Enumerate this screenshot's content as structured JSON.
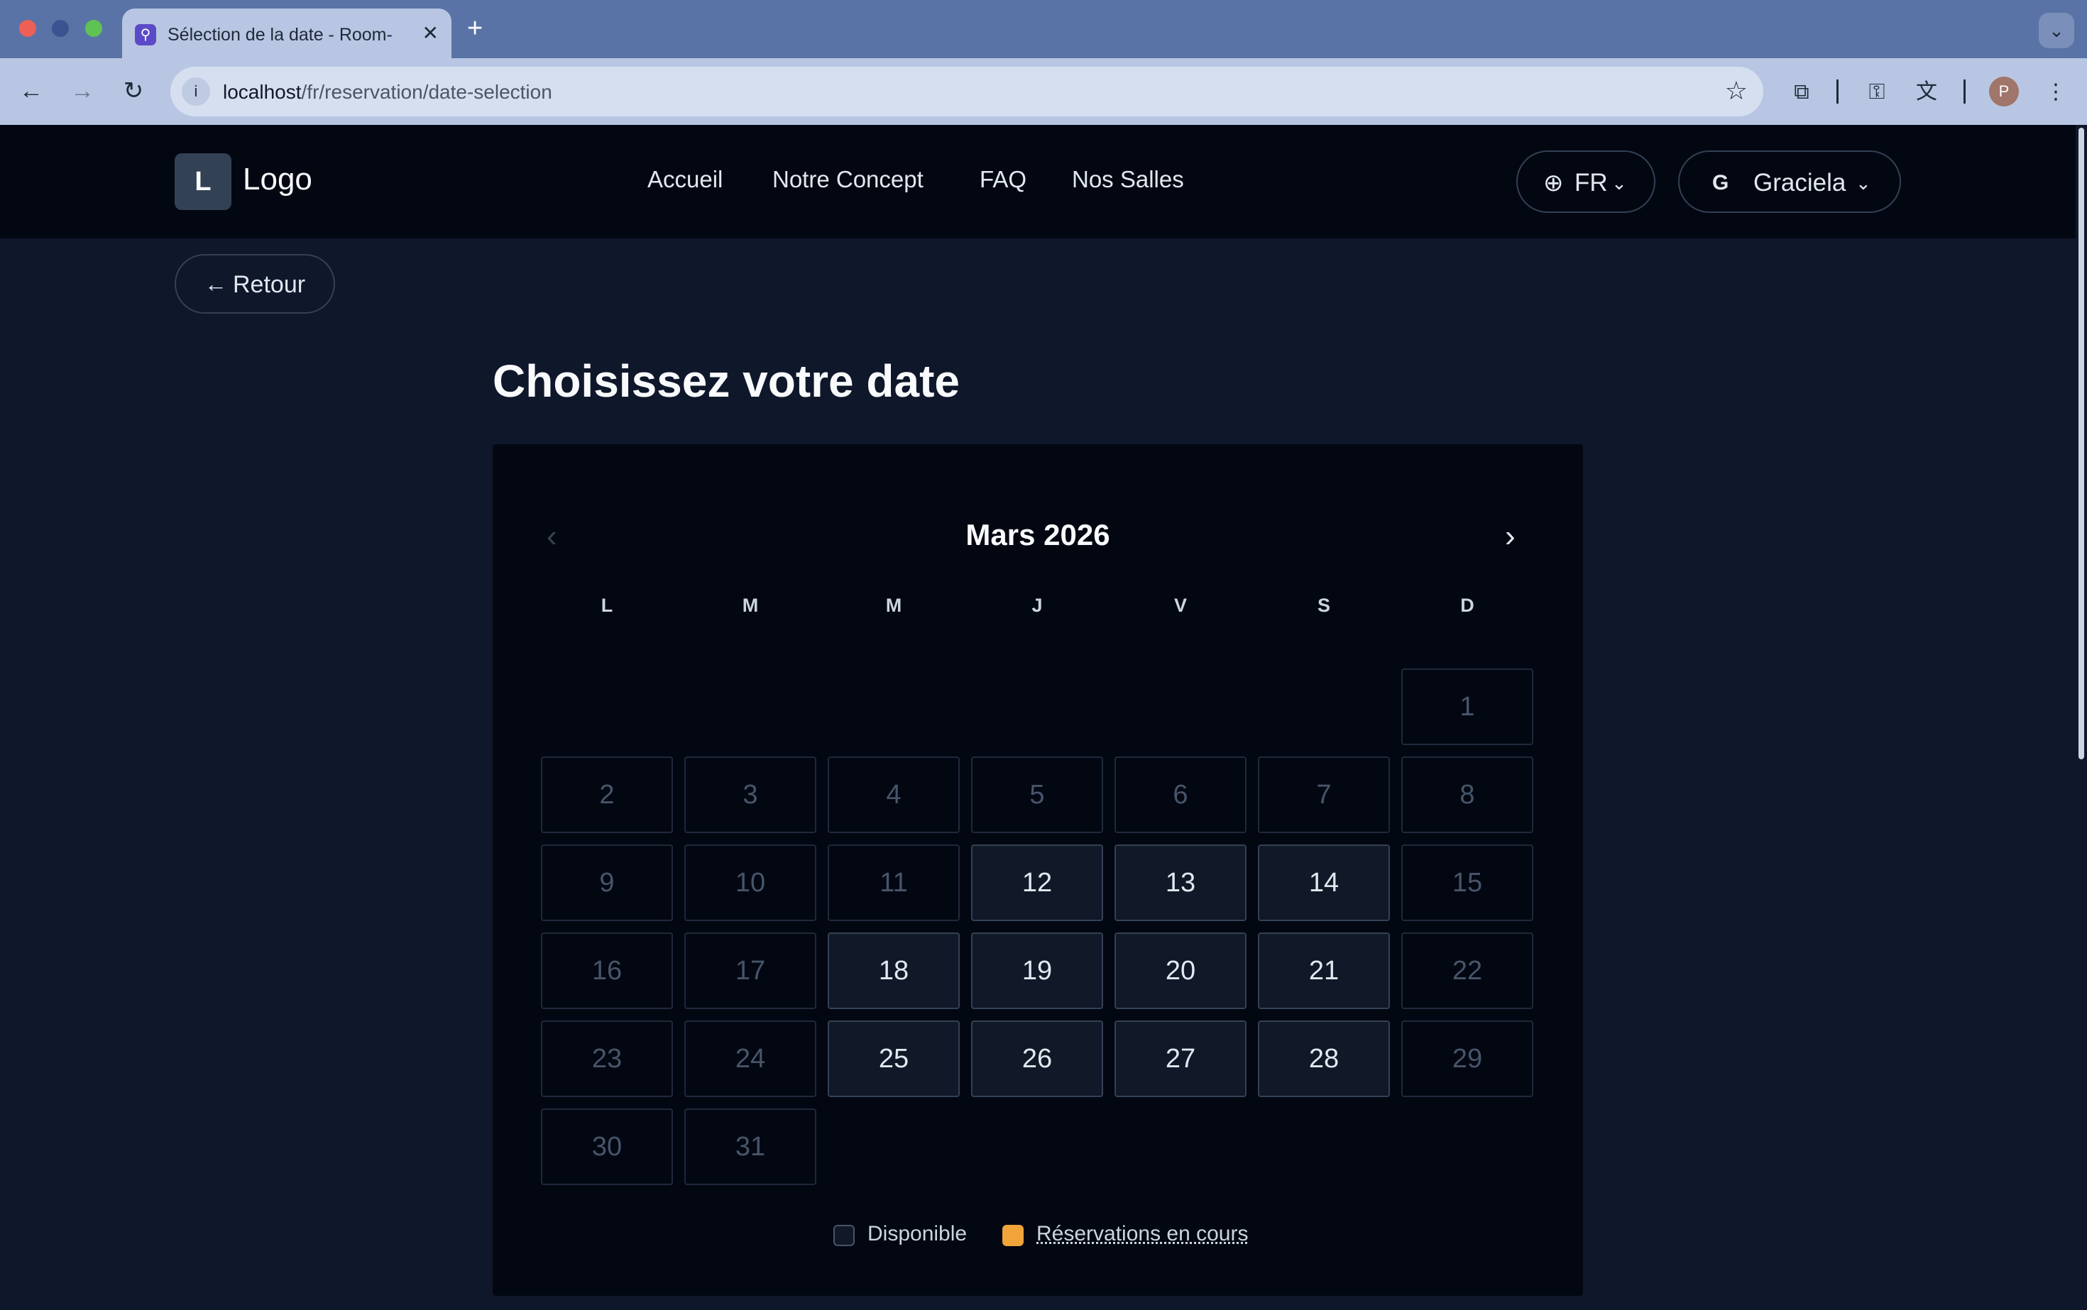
{
  "browser": {
    "tab_title": "Sélection de la date - Room-E",
    "url_host": "localhost",
    "url_path": "/fr/reservation/date-selection",
    "profile_initial": "P"
  },
  "header": {
    "logo_letter": "L",
    "logo_text": "Logo",
    "nav": [
      "Accueil",
      "Notre Concept",
      "FAQ",
      "Nos Salles"
    ],
    "lang": "FR",
    "user_initial": "G",
    "user_name": "Graciela"
  },
  "page": {
    "back_label": "Retour",
    "title": "Choisissez votre date"
  },
  "calendar": {
    "month_label": "Mars 2026",
    "weekdays": [
      "L",
      "M",
      "M",
      "J",
      "V",
      "S",
      "D"
    ],
    "first_weekday_index": 6,
    "days_in_month": 31,
    "available_days": [
      12,
      13,
      14,
      18,
      19,
      20,
      21,
      25,
      26,
      27,
      28
    ]
  },
  "legend": {
    "available": "Disponible",
    "pending": "Réservations en cours"
  },
  "colors": {
    "accent_pending": "#f0a43a",
    "background": "#0f172a"
  }
}
